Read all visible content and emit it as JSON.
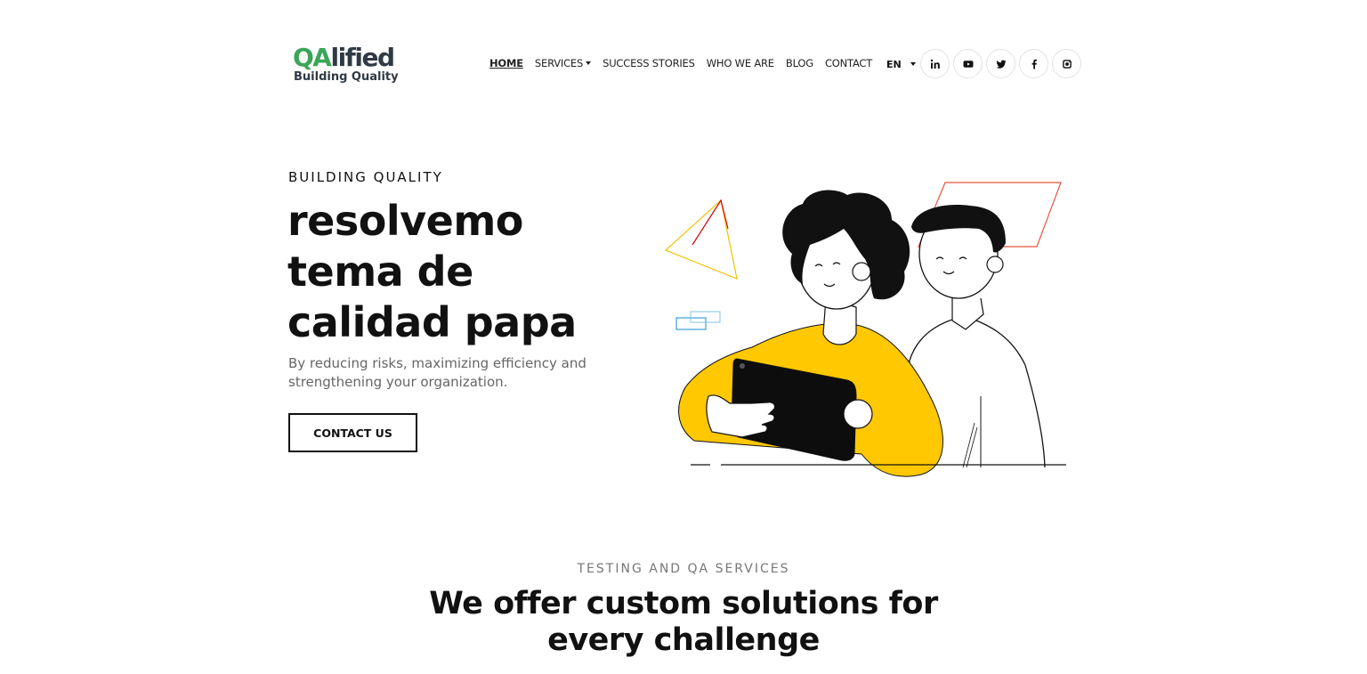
{
  "header": {
    "logo": {
      "word_a": "QA",
      "word_b": "lified",
      "tagline": "Building Quality"
    },
    "nav": [
      {
        "label": "HOME",
        "active": true
      },
      {
        "label": "SERVICES",
        "dropdown": true
      },
      {
        "label": "SUCCESS STORIES"
      },
      {
        "label": "WHO WE ARE"
      },
      {
        "label": "BLOG"
      },
      {
        "label": "CONTACT"
      }
    ],
    "language": "EN",
    "socials": [
      "linkedin-icon",
      "youtube-icon",
      "twitter-icon",
      "facebook-icon",
      "instagram-icon"
    ]
  },
  "hero": {
    "eyebrow": "BUILDING QUALITY",
    "title_lines": [
      "resolvemo",
      "tema de",
      "calidad papa"
    ],
    "subtitle": "By reducing risks, maximizing efficiency and strengthening your organization.",
    "cta_label": "CONTACT US"
  },
  "services": {
    "eyebrow": "TESTING AND QA SERVICES",
    "title": "We offer custom solutions for every challenge"
  },
  "colors": {
    "brand_green": "#3aa657",
    "brand_dark": "#2f3a45",
    "illustration_yellow": "#ffc800",
    "accent_red": "#e8553d",
    "accent_blue": "#3a9fd1"
  }
}
